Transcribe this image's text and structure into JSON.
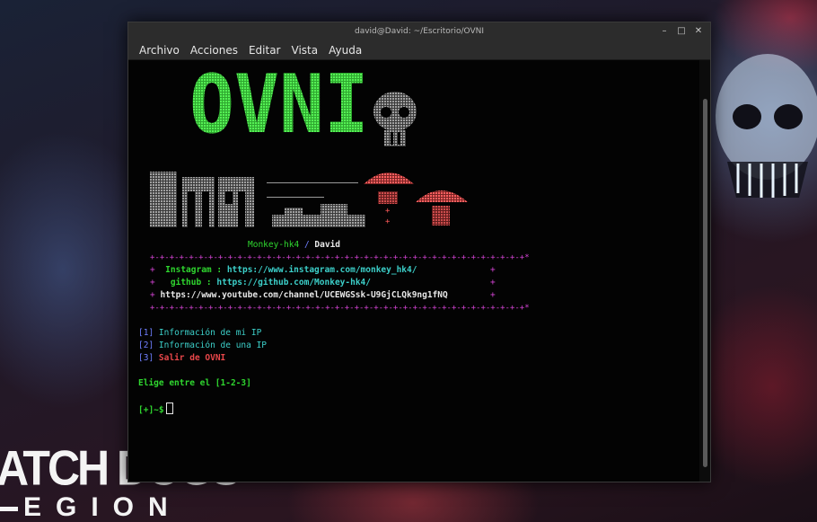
{
  "window": {
    "title": "david@David: ~/Escritorio/OVNI",
    "controls": [
      "–",
      "□",
      "✕"
    ]
  },
  "menu": [
    "Archivo",
    "Acciones",
    "Editar",
    "Vista",
    "Ayuda"
  ],
  "banner": {
    "title": "OVNI",
    "colors": {
      "title": "#3bdc3b",
      "skull": "#8a8a8a",
      "blocks": "#8d8d8d",
      "ufo": "#ff5a5a"
    }
  },
  "credits": {
    "author": "Monkey-hk4",
    "separator": "/",
    "user": "David",
    "border_top": "+-+-+-+-+-+-+-+-+-+-+-+-+-+-+-+-+-+-+-+-+-+-+-+-+-+-+-+-+-+-+-+-+-+-+-+-+-+-+*",
    "border_bottom": "+-+-+-+-+-+-+-+-+-+-+-+-+-+-+-+-+-+-+-+-+-+-+-+-+-+-+-+-+-+-+-+-+-+-+-+-+-+-+*",
    "instagram_label": "Instagram :",
    "instagram_url": "https://www.instagram.com/monkey_hk4/",
    "github_label": "github :",
    "github_url": "https://github.com/Monkey-hk4/",
    "youtube_url": "https://www.youtube.com/channel/UCEWGSsk-U9GjCLQk9ng1fNQ"
  },
  "options": [
    {
      "num": "[1]",
      "label": "Información de mi IP"
    },
    {
      "num": "[2]",
      "label": "Información de una IP"
    },
    {
      "num": "[3]",
      "label": "Salir de OVNI"
    }
  ],
  "prompt_text": "Elige entre el [1-2-3]",
  "shell_prompt": "[+]~$",
  "wallpaper": {
    "logo_line1": "ATCH DOGS",
    "logo_line2": "EGION"
  }
}
